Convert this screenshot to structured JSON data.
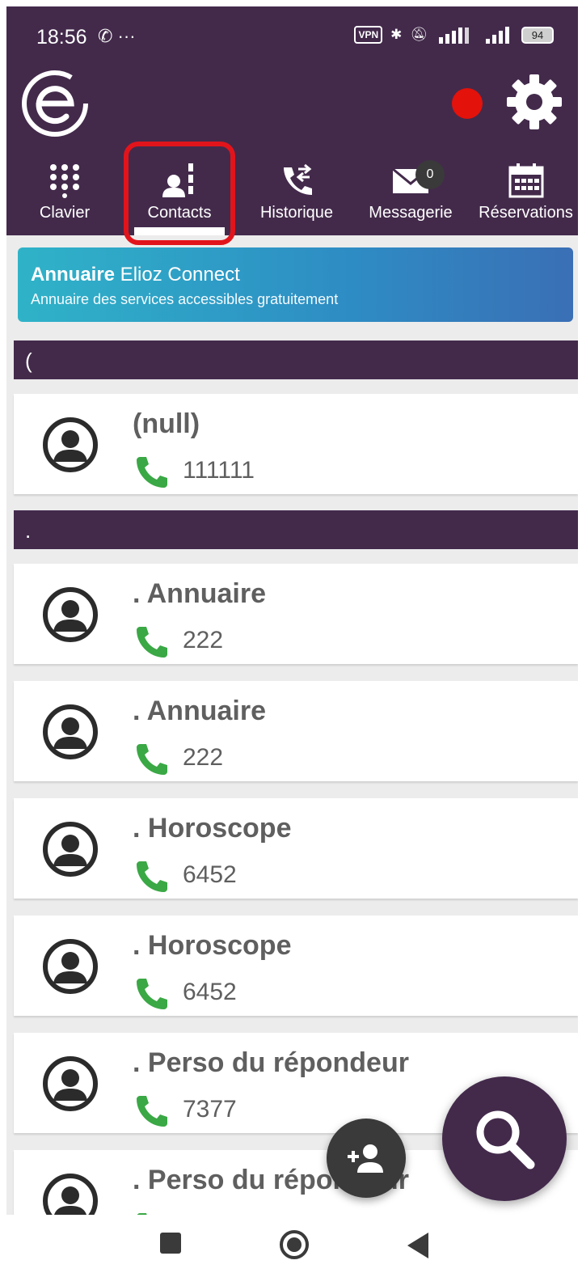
{
  "status_bar": {
    "time": "18:56",
    "left_icons": "✆ ···",
    "vpn": "VPN",
    "battery": "94"
  },
  "tabs": [
    {
      "label": "Clavier",
      "icon": "dialpad-icon",
      "active": false
    },
    {
      "label": "Contacts",
      "icon": "contacts-icon",
      "active": true
    },
    {
      "label": "Historique",
      "icon": "call-history-icon",
      "active": false
    },
    {
      "label": "Messagerie",
      "icon": "voicemail-icon",
      "active": false,
      "badge": "0"
    },
    {
      "label": "Réservations",
      "icon": "calendar-icon",
      "active": false
    }
  ],
  "banner": {
    "title_bold": "Annuaire",
    "title_rest": " Elioz Connect",
    "subtitle": "Annuaire des services accessibles gratuitement"
  },
  "sections": [
    {
      "header": "("
    },
    {
      "header": "."
    }
  ],
  "contacts": [
    {
      "name": "(null)",
      "number": "111111"
    },
    {
      "name": ". Annuaire",
      "number": "222"
    },
    {
      "name": ". Annuaire",
      "number": "222"
    },
    {
      "name": ". Horoscope",
      "number": "6452"
    },
    {
      "name": ". Horoscope",
      "number": "6452"
    },
    {
      "name": ". Perso du répondeur",
      "number": "7377"
    },
    {
      "name": ". Perso du répondeur",
      "number": ""
    }
  ],
  "colors": {
    "header": "#432a4b",
    "record_dot": "#e3120b",
    "highlight": "#e2141b",
    "phone_green": "#3aa845"
  }
}
